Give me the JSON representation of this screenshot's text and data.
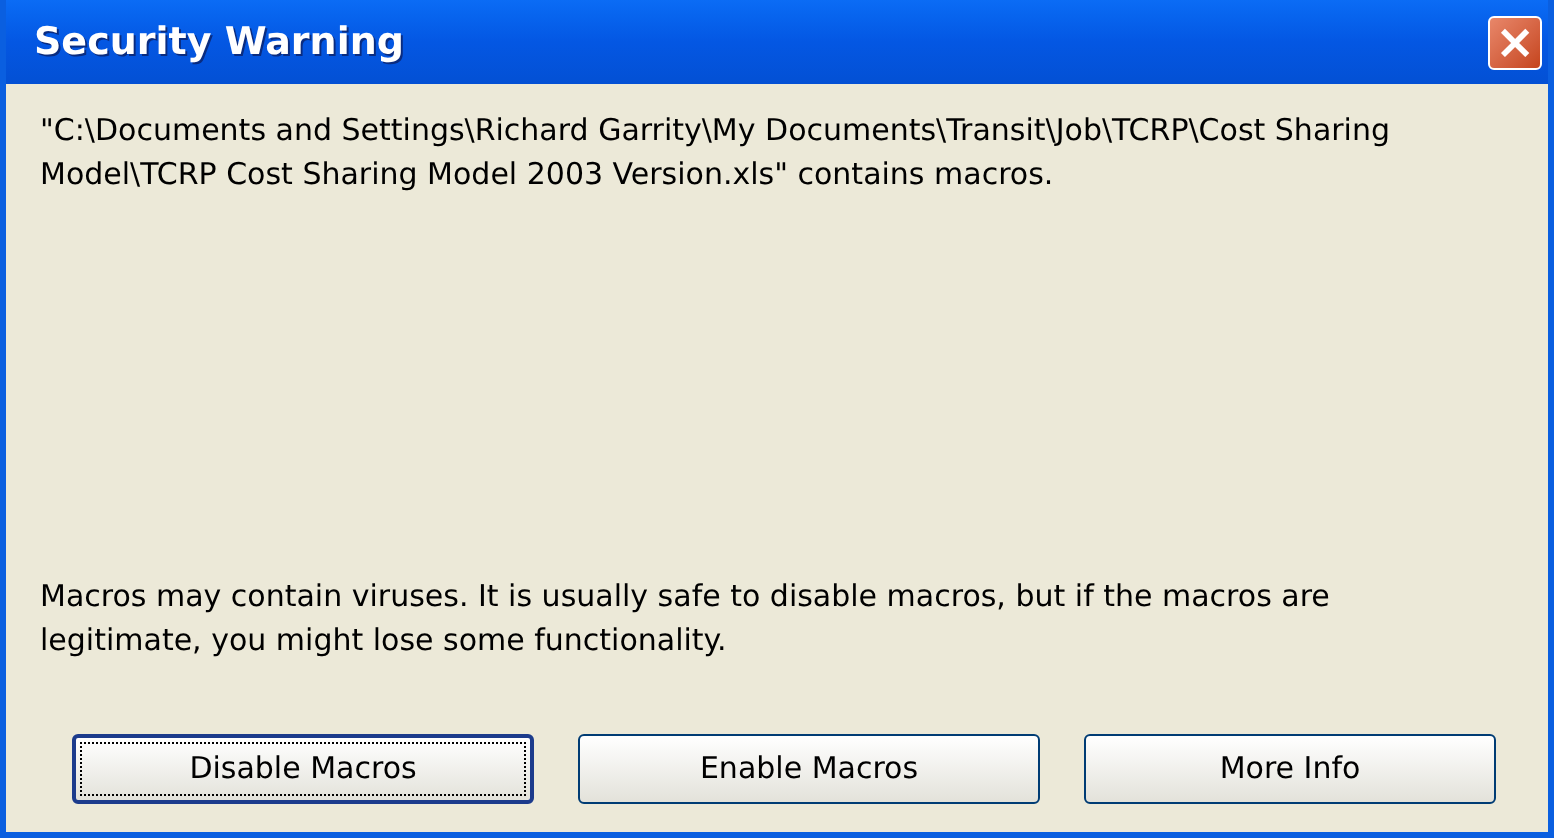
{
  "window": {
    "title": "Security Warning",
    "close": "×"
  },
  "message": "\"C:\\Documents and Settings\\Richard Garrity\\My Documents\\Transit\\Job\\TCRP\\Cost Sharing Model\\TCRP Cost Sharing Model 2003 Version.xls\" contains macros.",
  "warning": "Macros may contain viruses. It is usually safe to disable macros, but if the macros are legitimate, you might lose some functionality.",
  "buttons": [
    {
      "label": "Disable Macros",
      "focused": true
    },
    {
      "label": "Enable Macros",
      "focused": false
    },
    {
      "label": "More Info",
      "focused": false
    }
  ]
}
